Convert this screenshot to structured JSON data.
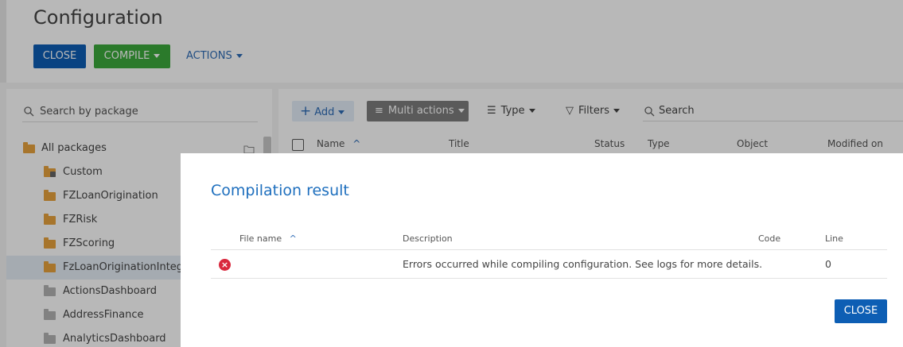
{
  "page": {
    "title": "Configuration",
    "close_label": "CLOSE",
    "compile_label": "COMPILE",
    "actions_label": "ACTIONS"
  },
  "packages": {
    "search_placeholder": "Search by package",
    "items": [
      {
        "label": "All packages",
        "icon": "folder-icon",
        "color": "#e8a33d"
      },
      {
        "label": "Custom",
        "icon": "locked-folder-icon",
        "color": "#e8a33d"
      },
      {
        "label": "FZLoanOrigination",
        "icon": "folder-icon",
        "color": "#e8a33d"
      },
      {
        "label": "FZRisk",
        "icon": "folder-icon",
        "color": "#e8a33d"
      },
      {
        "label": "FZScoring",
        "icon": "folder-icon",
        "color": "#e8a33d"
      },
      {
        "label": "FzLoanOriginationIntegra",
        "icon": "folder-icon",
        "color": "#e8a33d"
      },
      {
        "label": "ActionsDashboard",
        "icon": "folder-icon",
        "color": "#b3b3b3"
      },
      {
        "label": "AddressFinance",
        "icon": "folder-icon",
        "color": "#b3b3b3"
      },
      {
        "label": "AnalyticsDashboard",
        "icon": "folder-icon",
        "color": "#b3b3b3"
      }
    ]
  },
  "toolbar": {
    "add_label": "Add",
    "multi_actions_label": "Multi actions",
    "type_label": "Type",
    "filters_label": "Filters",
    "search_placeholder": "Search"
  },
  "grid": {
    "columns": [
      "Name",
      "Title",
      "Status",
      "Type",
      "Object",
      "Modified on"
    ]
  },
  "dialog": {
    "title": "Compilation result",
    "columns": {
      "file_name": "File name",
      "description": "Description",
      "code": "Code",
      "line": "Line"
    },
    "rows": [
      {
        "status_icon": "error-icon",
        "file_name": "",
        "description": "Errors occurred while compiling configuration. See logs for more details.",
        "code": "",
        "line": "0"
      }
    ],
    "close_label": "CLOSE"
  },
  "colors": {
    "primary": "#0d5eb4",
    "success": "#3ca93c",
    "error": "#d9283d",
    "link": "#2f6cb6"
  }
}
